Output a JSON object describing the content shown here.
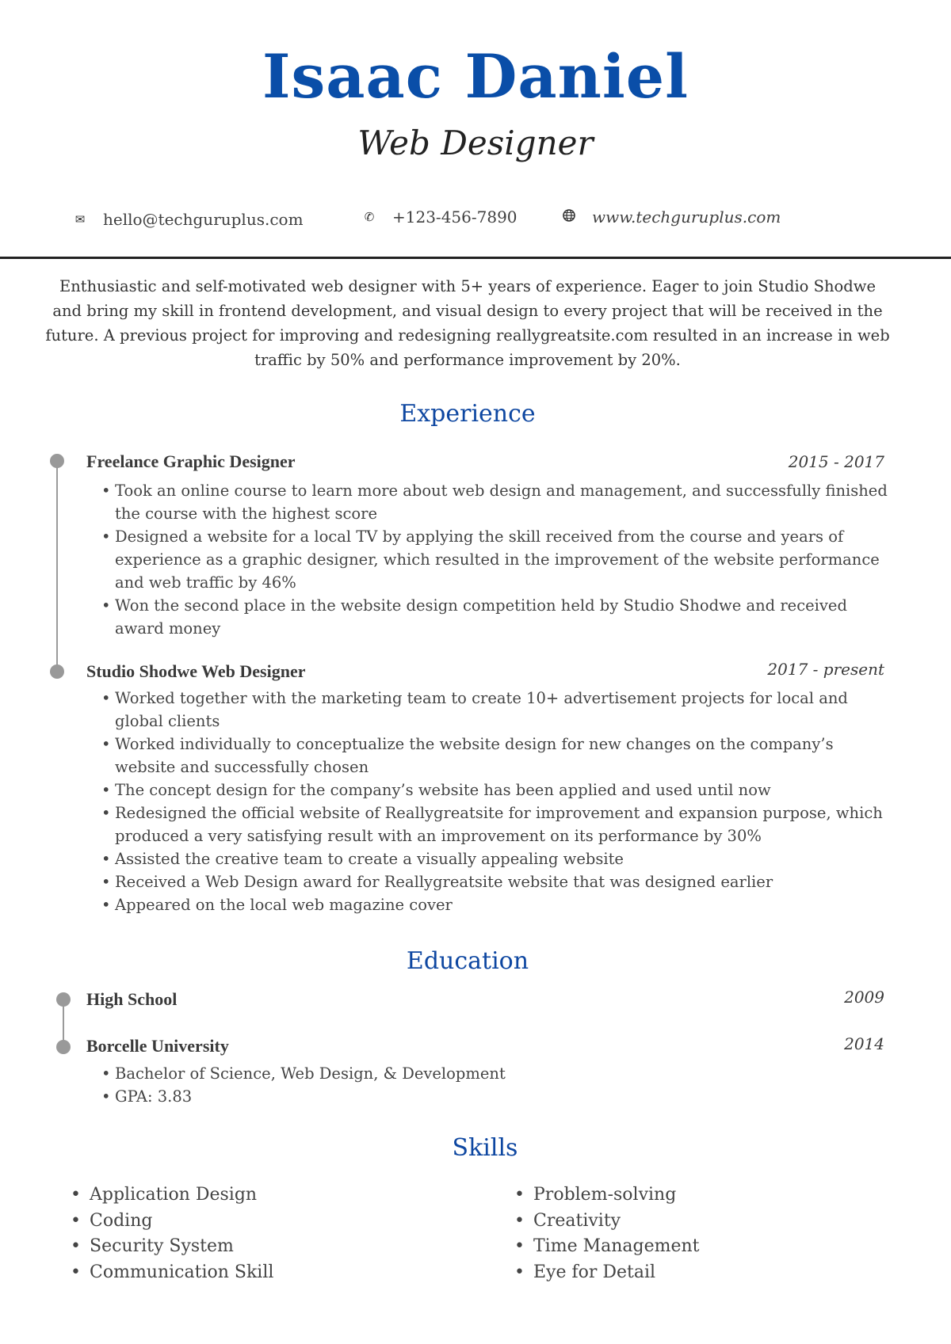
{
  "header": {
    "name": "Isaac Daniel",
    "title": "Web Designer"
  },
  "contact": {
    "email": {
      "icon": "envelope-icon",
      "glyph": "✉",
      "text": "hello@techguruplus.com"
    },
    "phone": {
      "icon": "phone-icon",
      "glyph": "✆",
      "text": "+123-456-7890"
    },
    "website": {
      "icon": "globe-icon",
      "glyph": "🌐",
      "text": "www.techguruplus.com"
    }
  },
  "summary": "Enthusiastic and self-motivated web designer with 5+ years of experience. Eager to join Studio Shodwe and bring my skill in frontend development, and visual design to every project that will be received in the future. A previous project for improving and redesigning reallygreatsite.com resulted in an increase in web traffic by 50% and performance improvement by 20%.",
  "experience": {
    "heading": "Experience",
    "entries": [
      {
        "title": "Freelance Graphic Designer",
        "date": "2015 - 2017",
        "bullets": [
          "Took an online course to learn more about web design and management, and successfully finished the course with the highest score",
          "Designed a website for a local TV by applying the skill received from the course and years of experience as a graphic designer, which resulted in the improvement of the website performance and web traffic by 46%",
          "Won the second place in the website design competition held by Studio Shodwe and received award money"
        ]
      },
      {
        "title": "Studio Shodwe Web Designer",
        "date": "2017 - present",
        "bullets": [
          "Worked together with the marketing team to create 10+ advertisement projects for local and global clients",
          "Worked individually to conceptualize the website design for new changes on the company’s website and successfully chosen",
          "The concept design for the company’s website has been applied and used until now",
          "Redesigned the official website of Reallygreatsite for improvement and expansion purpose, which produced a very satisfying result with an improvement on its performance by 30%",
          "Assisted the creative team to create a visually appealing website",
          "Received a Web Design award for Reallygreatsite website that was designed earlier",
          "Appeared on the local web magazine cover"
        ]
      }
    ]
  },
  "education": {
    "heading": "Education",
    "entries": [
      {
        "title": "High School",
        "date": "2009",
        "bullets": []
      },
      {
        "title": "Borcelle University",
        "date": "2014",
        "bullets": [
          "Bachelor of Science, Web Design, & Development",
          "GPA: 3.83"
        ]
      }
    ]
  },
  "skills": {
    "heading": "Skills",
    "left": [
      "Application Design",
      "Coding",
      "Security System",
      "Communication Skill"
    ],
    "right": [
      "Problem-solving",
      "Creativity",
      "Time Management",
      "Eye for Detail"
    ]
  },
  "colors": {
    "name": "#0a4ea8",
    "heading": "#0e47a1",
    "text": "#3a3a3a",
    "timeline": "#999999"
  }
}
